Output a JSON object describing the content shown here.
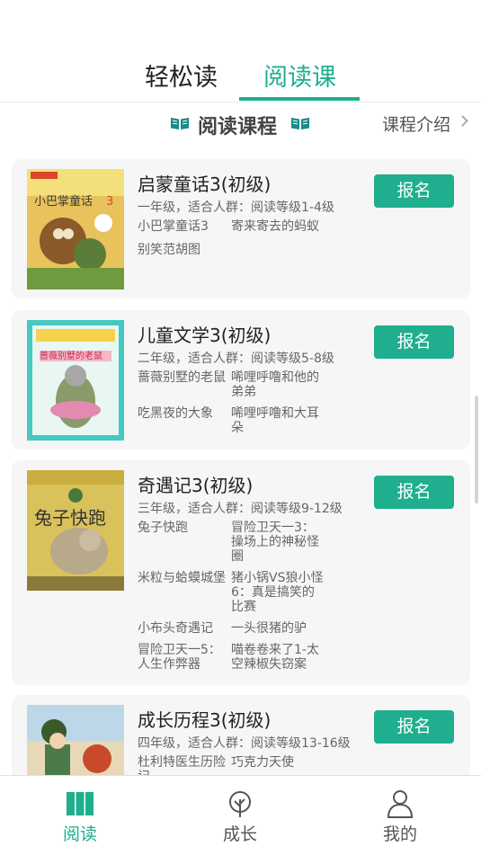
{
  "tabs": [
    {
      "label": "轻松读",
      "active": false
    },
    {
      "label": "阅读课",
      "active": true
    }
  ],
  "section": {
    "title": "阅读课程",
    "intro_link": "课程介绍"
  },
  "courses": [
    {
      "title": "启蒙童话3(初级)",
      "meta": "一年级，适合人群：阅读等级1-4级",
      "cover_title": "小巴掌童话",
      "cover_num": "3",
      "enroll_label": "报名",
      "books": [
        "小巴掌童话3",
        "寄来寄去的蚂蚁",
        "别笑范胡图"
      ]
    },
    {
      "title": "儿童文学3(初级)",
      "meta": "二年级，适合人群：阅读等级5-8级",
      "cover_title": "蔷薇别墅的老鼠",
      "enroll_label": "报名",
      "books": [
        "蔷薇别墅的老鼠",
        "唏哩呼噜和他的弟弟",
        "吃黑夜的大象",
        "唏哩呼噜和大耳朵"
      ]
    },
    {
      "title": "奇遇记3(初级)",
      "meta": "三年级，适合人群：阅读等级9-12级",
      "cover_title": "兔子快跑",
      "enroll_label": "报名",
      "books": [
        "兔子快跑",
        "冒险卫天一3：操场上的神秘怪圈",
        "米粒与蛤蟆城堡",
        "猪小锅VS狼小怪6：真是搞笑的比赛",
        "小布头奇遇记",
        "一头很猪的驴",
        "冒险卫天一5：人生作弊器",
        "喵卷卷来了1-太空辣椒失窃案"
      ]
    },
    {
      "title": "成长历程3(初级)",
      "meta": "四年级，适合人群：阅读等级13-16级",
      "enroll_label": "报名",
      "books": [
        "杜利特医生历险记",
        "巧克力天使"
      ]
    }
  ],
  "bottom_nav": [
    {
      "label": "阅读",
      "icon": "book-icon",
      "active": true
    },
    {
      "label": "成长",
      "icon": "sprout-icon",
      "active": false
    },
    {
      "label": "我的",
      "icon": "person-icon",
      "active": false
    }
  ],
  "colors": {
    "accent": "#1fae8e",
    "card_bg": "#f6f6f6"
  }
}
